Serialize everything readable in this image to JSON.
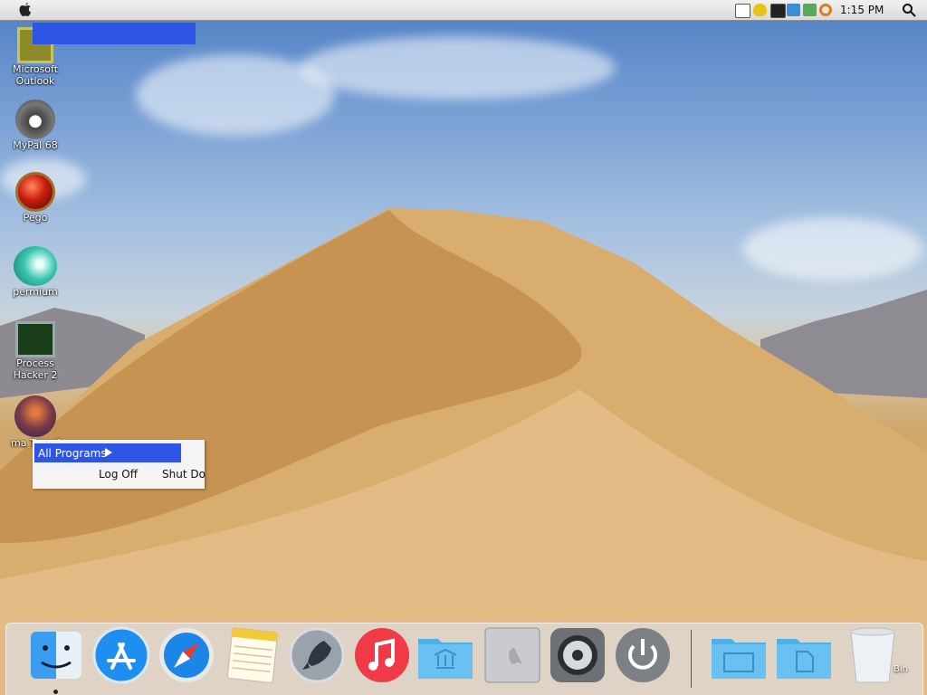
{
  "menubar": {
    "clock": "1:15 PM",
    "icons": [
      "apple-icon",
      "keyboard-icon",
      "shield-icon",
      "grid-icon",
      "monitor-icon",
      "network-icon",
      "key-icon",
      "search-icon"
    ]
  },
  "desktop_icons": [
    {
      "name": "microsoft-outlook",
      "label": "Microsoft Outlook"
    },
    {
      "name": "mypal",
      "label": "MyPal 68"
    },
    {
      "name": "pego",
      "label": "Pego"
    },
    {
      "name": "permium",
      "label": "permium"
    },
    {
      "name": "process-hacker",
      "label": "Process Hacker 2"
    },
    {
      "name": "mac-transform",
      "label": "ma Transf"
    }
  ],
  "start_menu": {
    "all_programs": "All Programs",
    "log_off": "Log Off",
    "shut_down": "Shut Dov"
  },
  "dock": {
    "items": [
      "finder",
      "app-store",
      "safari",
      "notes",
      "launchpad",
      "music",
      "applications-folder",
      "mac-pro",
      "system-preferences",
      "power",
      "desktop-folder",
      "documents-folder",
      "trash"
    ],
    "trash_label": "Bin"
  },
  "colors": {
    "selection": "#2f55e6",
    "menubar": "#e6e6e6"
  }
}
